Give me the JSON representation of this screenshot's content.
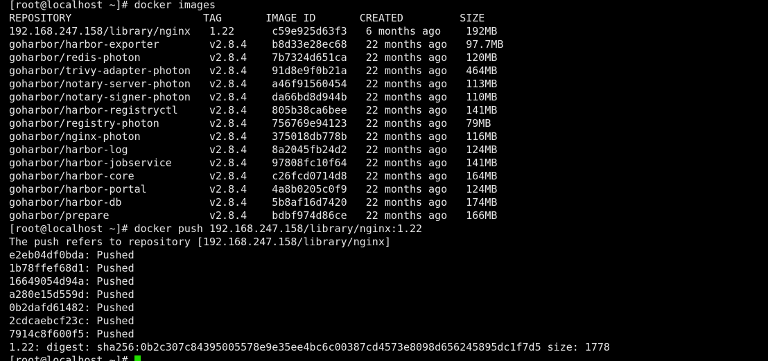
{
  "terminal": {
    "colors": {
      "background": "#000000",
      "foreground": "#e5e5e5",
      "cursor": "#22e000"
    },
    "lines": [
      "[root@localhost ~]# docker images",
      "REPOSITORY                     TAG       IMAGE ID       CREATED         SIZE",
      "192.168.247.158/library/nginx   1.22      c59e925d63f3   6 months ago    192MB",
      "goharbor/harbor-exporter        v2.8.4    b8d33e28ec68   22 months ago   97.7MB",
      "goharbor/redis-photon           v2.8.4    7b7324d651ca   22 months ago   120MB",
      "goharbor/trivy-adapter-photon   v2.8.4    91d8e9f0b21a   22 months ago   464MB",
      "goharbor/notary-server-photon   v2.8.4    a46f91560454   22 months ago   113MB",
      "goharbor/notary-signer-photon   v2.8.4    da66bd8d944b   22 months ago   110MB",
      "goharbor/harbor-registryctl     v2.8.4    805b38ca6bee   22 months ago   141MB",
      "goharbor/registry-photon        v2.8.4    756769e94123   22 months ago   79MB",
      "goharbor/nginx-photon           v2.8.4    375018db778b   22 months ago   116MB",
      "goharbor/harbor-log             v2.8.4    8a2045fb24d2   22 months ago   124MB",
      "goharbor/harbor-jobservice      v2.8.4    97808fc10f64   22 months ago   141MB",
      "goharbor/harbor-core            v2.8.4    c26fcd0714d8   22 months ago   164MB",
      "goharbor/harbor-portal          v2.8.4    4a8b0205c0f9   22 months ago   124MB",
      "goharbor/harbor-db              v2.8.4    5b8af16d7420   22 months ago   174MB",
      "goharbor/prepare                v2.8.4    bdbf974d86ce   22 months ago   166MB",
      "[root@localhost ~]# docker push 192.168.247.158/library/nginx:1.22",
      "The push refers to repository [192.168.247.158/library/nginx]",
      "e2eb04df0bda: Pushed",
      "1b78ffef68d1: Pushed",
      "16649054d94a: Pushed",
      "a280e15d559d: Pushed",
      "0b2dafd61482: Pushed",
      "2cdcaebcf23c: Pushed",
      "7914c8f600f5: Pushed",
      "1.22: digest: sha256:0b2c307c84395005578e9e35ee4bc6c00387cd4573e8098d656245895dc1f7d5 size: 1778"
    ],
    "prompt": "[root@localhost ~]# "
  }
}
